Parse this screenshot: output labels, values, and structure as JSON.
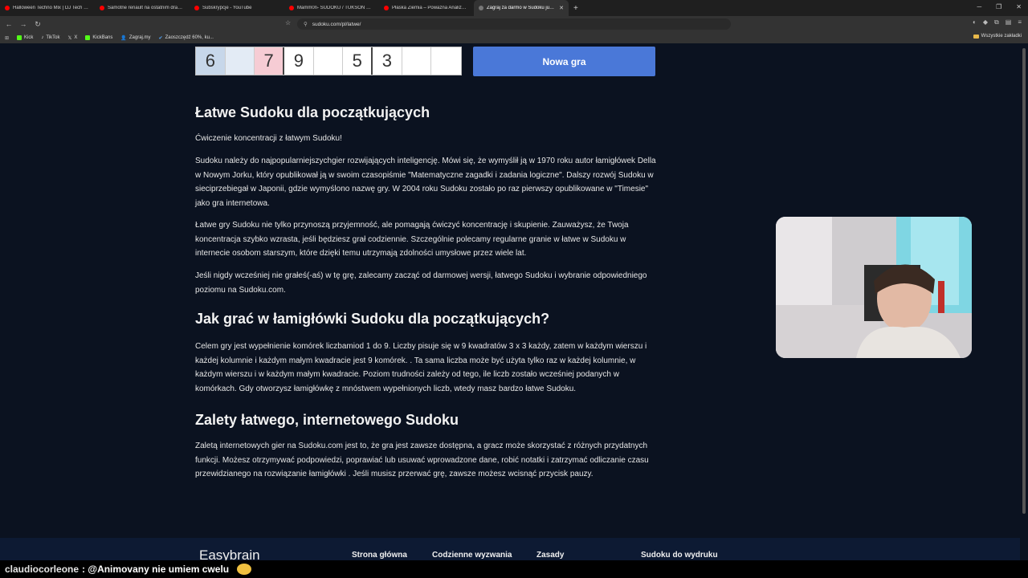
{
  "browser": {
    "tabs": [
      {
        "title": "Halloween Techno Mix | DJ Tech Wiz",
        "icon": "youtube-icon",
        "active": false
      },
      {
        "title": "Samotne renault na ostatnim drawie",
        "icon": "youtube-icon",
        "active": false
      },
      {
        "title": "Subskrypcje - YouTube",
        "icon": "youtube-icon",
        "active": false
      },
      {
        "title": "Mamm0n- SUDOKU / TUKSON MA C",
        "icon": "youtube-icon",
        "active": false
      },
      {
        "title": "Płaska Ziemia – Poważna Analiza (cz",
        "icon": "youtube-icon",
        "active": false
      },
      {
        "title": "Zagraj za darmo w Sudoku już te",
        "icon": "sudoku-icon",
        "active": true
      }
    ],
    "url": "sudoku.com/pl/latwe/",
    "bookmarks": [
      "Kick",
      "TikTok",
      "X",
      "KickBans",
      "Zagraj.my",
      "Zaoszczędź 60%, ku..."
    ],
    "all_bookmarks_label": "Wszystkie zakładki"
  },
  "sudoku_row": [
    {
      "value": "6",
      "state": "sel"
    },
    {
      "value": "",
      "state": "hl"
    },
    {
      "value": "7",
      "state": "err"
    },
    {
      "value": "9",
      "state": ""
    },
    {
      "value": "",
      "state": ""
    },
    {
      "value": "5",
      "state": ""
    },
    {
      "value": "3",
      "state": ""
    },
    {
      "value": "",
      "state": ""
    },
    {
      "value": "",
      "state": ""
    }
  ],
  "new_game_label": "Nowa gra",
  "article": {
    "h1": "Łatwe Sudoku dla początkujących",
    "intro": "Ćwiczenie koncentracji z łatwym Sudoku!",
    "p1": "Sudoku należy do najpopularniejszychgier rozwijających inteligencję. Mówi się, że wymyślił ją w 1970 roku autor łamigłówek Della w Nowym Jorku, który opublikował ją w swoim czasopiśmie \"Matematyczne zagadki i zadania logiczne\". Dalszy rozwój Sudoku w sieciprzebiegał w Japonii, gdzie wymyślono nazwę gry. W 2004 roku Sudoku zostało po raz pierwszy opublikowane w \"Timesie\" jako gra internetowa.",
    "p2": "Łatwe gry Sudoku nie tylko przynoszą przyjemność, ale pomagają ćwiczyć koncentrację i skupienie. Zauważysz, że Twoja koncentracja szybko wzrasta, jeśli będziesz grał codziennie. Szczególnie polecamy regularne granie w łatwe w Sudoku w internecie osobom starszym, które dzięki temu utrzymają zdolności umysłowe przez wiele lat.",
    "p3": "Jeśli nigdy wcześniej nie grałeś(-aś) w tę grę, zalecamy zacząć od darmowej wersji, łatwego Sudoku i wybranie odpowiedniego poziomu na Sudoku.com.",
    "h2": "Jak grać w łamigłówki Sudoku dla początkujących?",
    "p4": "Celem gry jest wypełnienie komórek liczbamiod 1 do 9. Liczby pisuje się w 9 kwadratów 3 x 3 każdy, zatem w każdym wierszu i każdej kolumnie i każdym małym kwadracie jest 9 komórek. . Ta sama liczba może być użyta tylko raz w każdej kolumnie, w każdym wierszu i w każdym małym kwadracie. Poziom trudności zależy od tego, ile liczb zostało wcześniej podanych w komórkach. Gdy otworzysz łamigłówkę z mnóstwem wypełnionych liczb, wtedy masz bardzo łatwe Sudoku.",
    "h3": "Zalety łatwego, internetowego Sudoku",
    "p5": "Zaletą internetowych gier na Sudoku.com jest to, że gra jest zawsze dostępna, a gracz może skorzystać z różnych przydatnych funkcji. Możesz otrzymywać podpowiedzi, poprawiać lub usuwać wprowadzone dane, robić notatki i zatrzymać odliczanie czasu przewidzianego na rozwiązanie łamigłówki . Jeśli musisz przerwać grę, zawsze możesz wcisnąć przycisk pauzy."
  },
  "footer": {
    "brand": "Easybrain",
    "links": [
      "Strona główna",
      "Codzienne wyzwania",
      "Zasady",
      "Sudoku do wydruku"
    ]
  },
  "chat": {
    "user": "claudiocorleone",
    "message": ": @Animovany nie umiem cwelu"
  }
}
